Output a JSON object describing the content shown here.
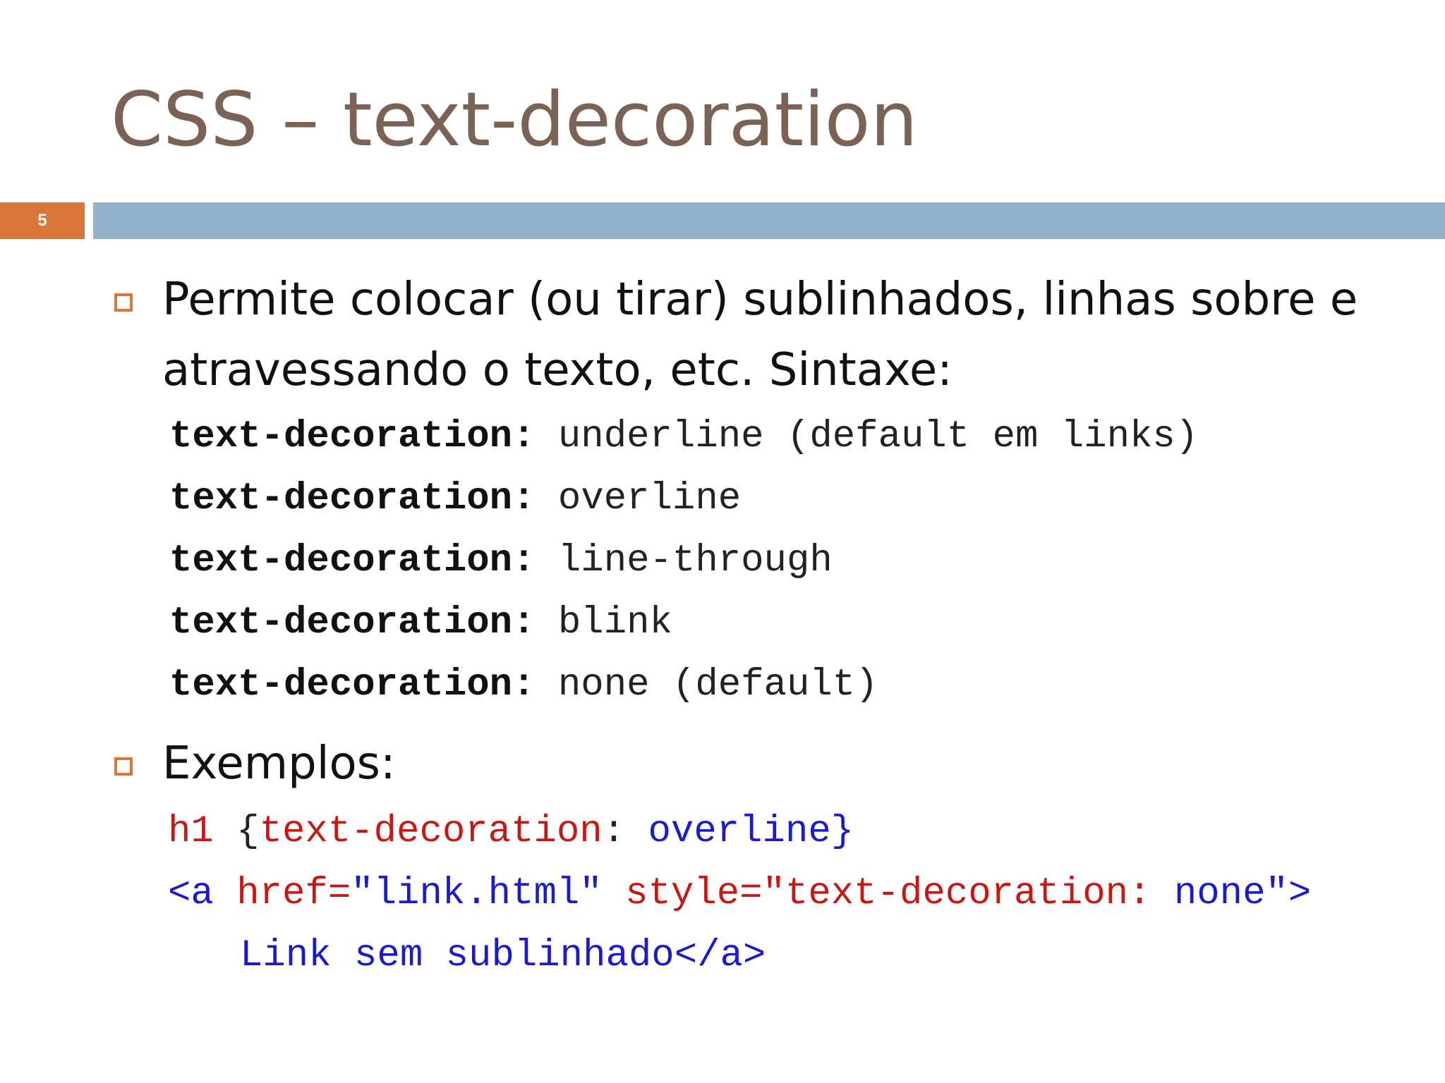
{
  "slide": {
    "title": "CSS – text-decoration",
    "number": "5",
    "colors": {
      "title": "#7a6255",
      "accent_orange": "#d9773b",
      "bar_blue": "#92b1cc",
      "code_red": "#c41a16",
      "code_blue": "#1b1bc8"
    }
  },
  "bullets": [
    {
      "text_line1": "Permite colocar (ou tirar) sublinhados, linhas sobre e",
      "text_line2": "atravessando o texto, etc. Sintaxe:"
    },
    {
      "text": "Exemplos:"
    }
  ],
  "syntax_lines": [
    {
      "property": "text-decoration:",
      "value": "underline (default em links)"
    },
    {
      "property": "text-decoration:",
      "value": "overline"
    },
    {
      "property": "text-decoration:",
      "value": "line-through"
    },
    {
      "property": "text-decoration:",
      "value": "blink"
    },
    {
      "property": "text-decoration:",
      "value": "none (default)"
    }
  ],
  "examples": {
    "line1": {
      "selector": "h1",
      "open_brace": "{",
      "property": "text-decoration",
      "colon": ":",
      "value": "overline",
      "close_brace": "}"
    },
    "line2": {
      "tag_open": "<a",
      "attr_href": "href=",
      "href_value": "\"link.html\"",
      "attr_style": "style=",
      "style_value_red": "\"text-decoration:",
      "style_value_blue": "none\">"
    },
    "line3": {
      "text": "Link sem sublinhado</a>"
    }
  }
}
